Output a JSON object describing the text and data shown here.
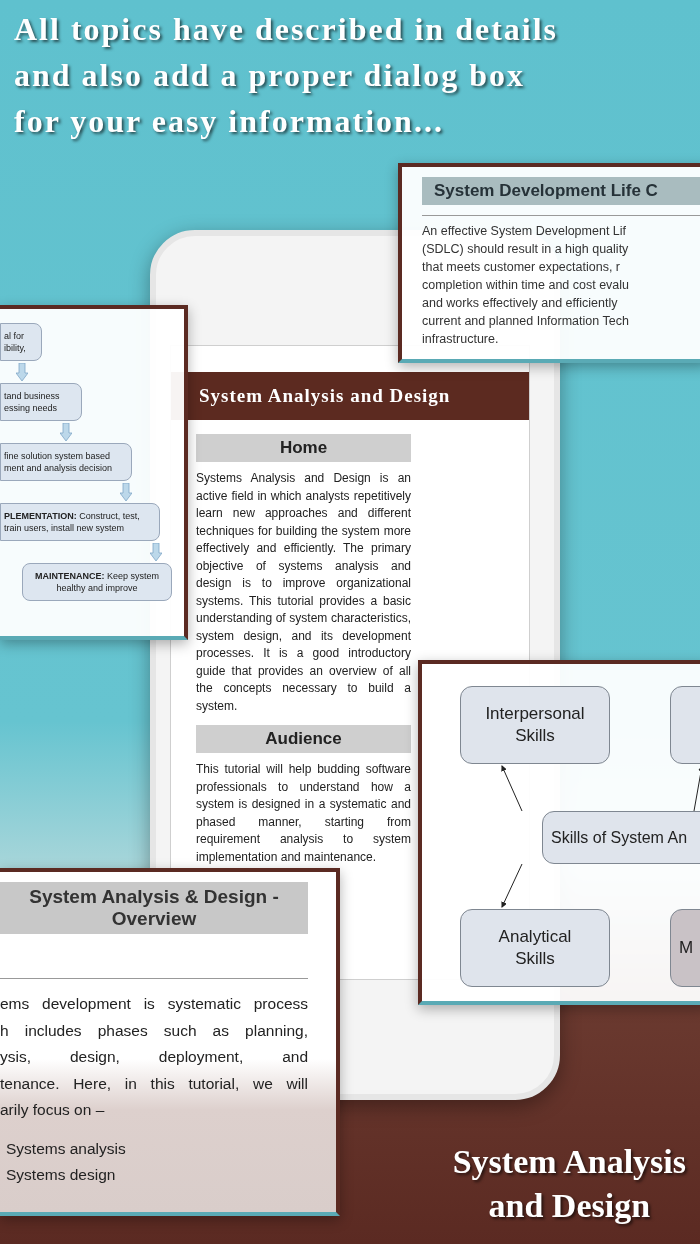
{
  "headline": [
    "All topics have described in details",
    "and also add a proper dialog box",
    "for your easy information..."
  ],
  "sdlc_card": {
    "title": "System Development Life C",
    "lines": [
      "An effective System Development Lif",
      "(SDLC) should result in a high quality",
      "that meets customer expectations, r",
      "completion within time and cost evalu",
      "and works effectively and efficiently",
      "current and planned Information Tech",
      "infrastructure."
    ]
  },
  "flowchart_card": {
    "steps": [
      {
        "text": "al for\nibility,"
      },
      {
        "text": "tand business\nessing needs"
      },
      {
        "text": "fine solution system based\nment and analysis decision"
      },
      {
        "text": "**PLEMENTATION:** Construct, test,\ntrain users, install new system"
      },
      {
        "text": "**MAINTENANCE:** Keep system\nhealthy and improve"
      }
    ]
  },
  "phone_screen": {
    "title": "System Analysis and Design",
    "sections": [
      {
        "heading": "Home",
        "body": "Systems Analysis and Design is an active field in which analysts repetitively learn new approaches and different techniques for building the system more effectively and efficiently. The primary objective of systems analysis and design is to improve organizational systems. This tutorial provides a basic understanding of system characteristics, system design, and its development processes. It is a good introductory guide that provides an overview of all the concepts necessary to build a system."
      },
      {
        "heading": "Audience",
        "body": "This tutorial will help budding software professionals to understand how a system is designed in a systematic and phased manner, starting from requirement analysis to system implementation and maintenance."
      }
    ]
  },
  "skills_card": {
    "nodes": [
      {
        "kind": "skill",
        "label": "Interpersonal Skills"
      },
      {
        "kind": "blank"
      },
      {
        "kind": "center",
        "label": "Skills of System An"
      },
      {
        "kind": "skill",
        "label": "Analytical Skills"
      },
      {
        "kind": "cut",
        "label": "M"
      }
    ]
  },
  "overview_card": {
    "title": "System Analysis & Design - Overview",
    "lines": [
      "ems development is systematic process",
      "h includes phases such as planning,",
      "ysis, design, deployment, and",
      "tenance. Here, in this tutorial, we will",
      "arily focus on –"
    ],
    "bullets": [
      "Systems analysis",
      "Systems design"
    ]
  },
  "caption": [
    "System Analysis",
    "and Design"
  ]
}
